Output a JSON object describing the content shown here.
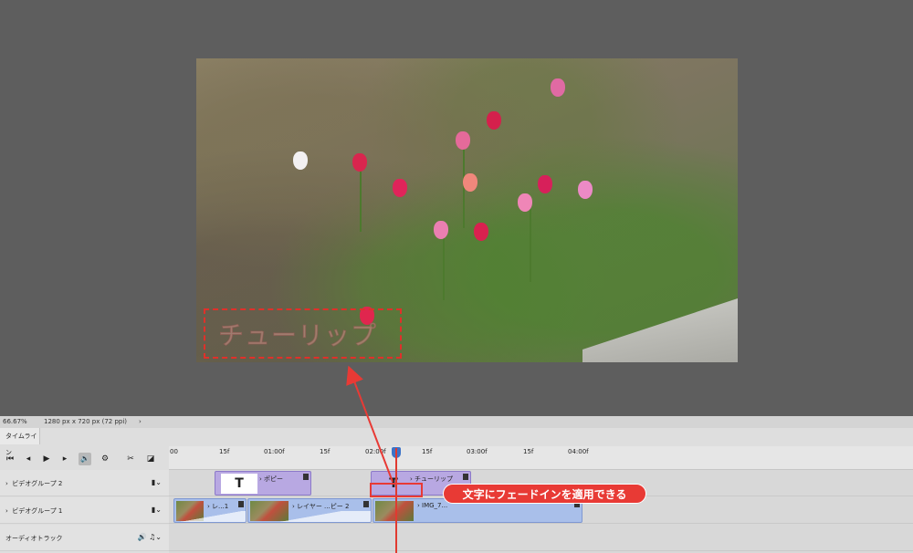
{
  "preview": {
    "overlay_text": "チューリップ"
  },
  "status_bar": {
    "zoom": "66.67%",
    "document_info": "1280 px x 720 px (72 ppi)",
    "chevron": "›"
  },
  "panel": {
    "tab_label": "タイムライン"
  },
  "controls": {
    "first_frame": "⏮",
    "prev_frame": "◂",
    "play": "▶",
    "next_frame": "▸",
    "audio": "🔊",
    "settings": "⚙",
    "split": "✂",
    "transition": "◪"
  },
  "ruler": {
    "ticks": [
      "00",
      "15f",
      "01:00f",
      "15f",
      "02:00f",
      "15f",
      "03:00f",
      "15f",
      "04:00f"
    ]
  },
  "tracks": {
    "video_group_2": "ビデオグループ 2",
    "video_group_1": "ビデオグループ 1",
    "audio_track": "オーディオトラック"
  },
  "clips": {
    "poppy": "ポピー",
    "tulip_text": "チューリップ",
    "text_icon": "T",
    "layer1": "レ...1",
    "layer2": "レイヤー ...ピー 2",
    "img": "IMG_7..."
  },
  "callout": {
    "text": "文字にフェードインを適用できる"
  },
  "colors": {
    "accent_red": "#e83a35",
    "clip_purple": "#b8a8e2",
    "clip_blue": "#a9bfea",
    "playhead_blue": "#3c73c8"
  }
}
